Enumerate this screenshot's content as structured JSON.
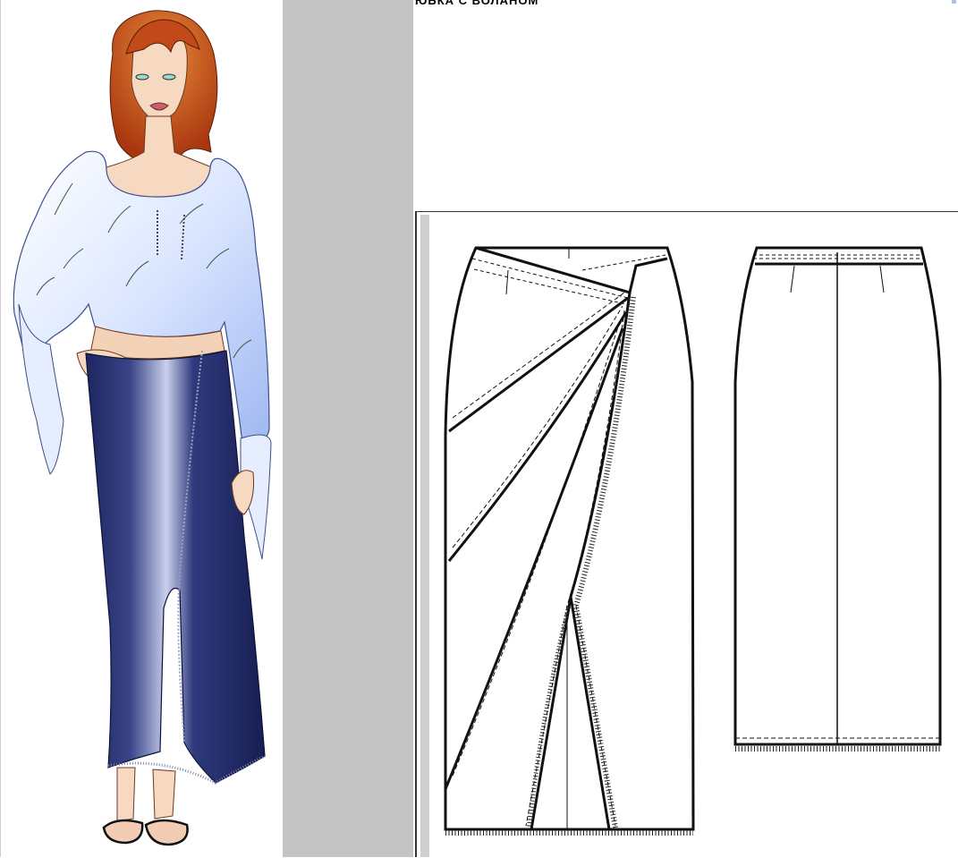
{
  "page": {
    "title": "ЮБКА С ВОЛАНОМ"
  },
  "colors": {
    "gutter": "#c4c4c4",
    "skirt": "#2a3470",
    "blouse": "#e6eeff",
    "hair": "#c24a1a",
    "outline": "#111111"
  },
  "icons": {
    "corner_mark": "selection-corner-icon"
  }
}
